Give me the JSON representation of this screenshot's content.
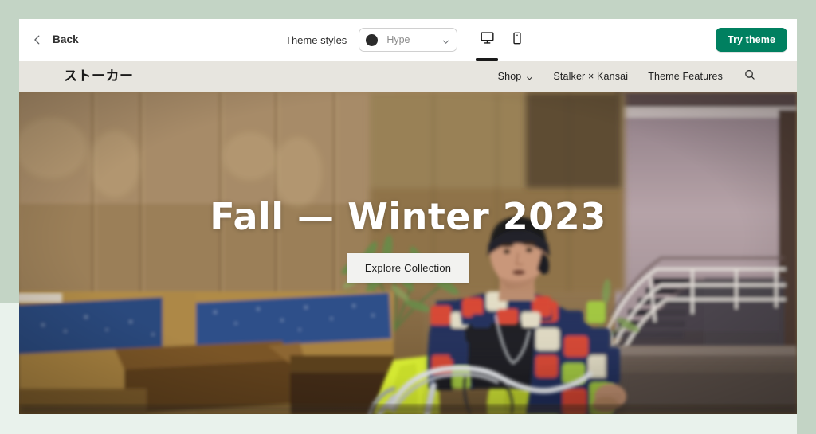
{
  "toolbar": {
    "back_label": "Back",
    "back_icon": "chevron-left-icon",
    "theme_styles_label": "Theme styles",
    "style_select": {
      "value": "Hype",
      "swatch_color": "#2b2b2b",
      "caret_icon": "chevron-down-icon"
    },
    "devices": [
      {
        "name": "desktop",
        "icon": "desktop-icon",
        "active": true
      },
      {
        "name": "mobile",
        "icon": "mobile-icon",
        "active": false
      }
    ],
    "try_theme_label": "Try theme",
    "try_theme_color": "#008060"
  },
  "store_nav": {
    "logo": "ストーカー",
    "links": [
      {
        "label": "Shop",
        "has_caret": true
      },
      {
        "label": "Stalker × Kansai",
        "has_caret": false
      },
      {
        "label": "Theme Features",
        "has_caret": false
      }
    ],
    "search_icon": "search-icon"
  },
  "hero": {
    "title": "Fall — Winter 2023",
    "cta_label": "Explore Collection",
    "alt": "Person in colorful patchwork knit jacket and neon yellow pants riding a bicycle in a wood-panelled interior with a staircase"
  },
  "colors": {
    "page_background": "#c3d4c5",
    "page_background_lower": "#e9f2ec",
    "panel": "#ffffff",
    "store_nav_background": "#e7e5df",
    "accent_green": "#008060"
  }
}
